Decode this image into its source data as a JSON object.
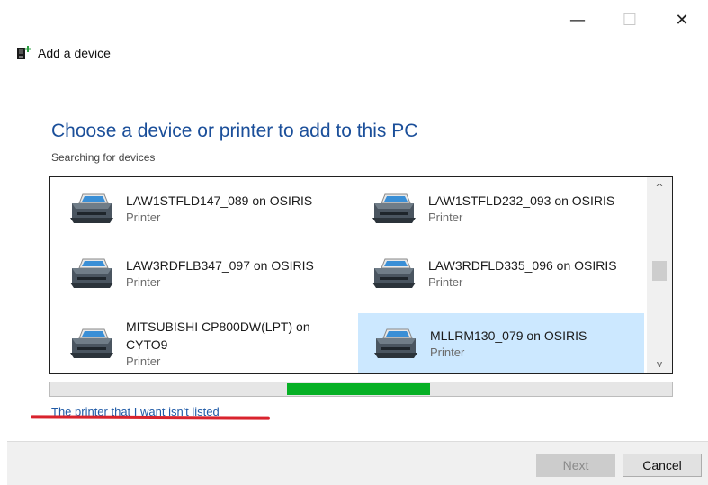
{
  "window": {
    "controls": {
      "minimize_glyph": "—",
      "maximize_glyph": "☐",
      "close_glyph": "✕"
    },
    "app_title": "Add a device",
    "app_icon": "add-device-icon"
  },
  "main": {
    "heading": "Choose a device or printer to add to this PC",
    "status": "Searching for devices"
  },
  "devices": [
    {
      "name": "LAW1STFLD147_089 on OSIRIS",
      "type": "Printer",
      "selected": false,
      "icon": "printer-icon"
    },
    {
      "name": "LAW1STFLD232_093 on OSIRIS",
      "type": "Printer",
      "selected": false,
      "icon": "printer-icon"
    },
    {
      "name": "LAW3RDFLB347_097 on OSIRIS",
      "type": "Printer",
      "selected": false,
      "icon": "printer-icon"
    },
    {
      "name": "LAW3RDFLD335_096 on OSIRIS",
      "type": "Printer",
      "selected": false,
      "icon": "printer-icon"
    },
    {
      "name": "MITSUBISHI CP800DW(LPT) on CYTO9",
      "type": "Printer",
      "selected": false,
      "icon": "printer-icon"
    },
    {
      "name": "MLLRM130_079 on OSIRIS",
      "type": "Printer",
      "selected": true,
      "icon": "printer-icon"
    }
  ],
  "scroll": {
    "up_glyph": "^",
    "down_glyph": "v"
  },
  "progress": {
    "indeterminate": true,
    "segment_start": 0.38,
    "segment_end": 0.61,
    "color": "#06b025"
  },
  "link": {
    "label": "The printer that I want isn't listed"
  },
  "footer": {
    "next_label": "Next",
    "cancel_label": "Cancel",
    "next_enabled": false
  },
  "colors": {
    "accent": "#1b4f9a",
    "selection": "#cce8ff",
    "link": "#1f5aa6",
    "annotation": "#d9232d"
  }
}
